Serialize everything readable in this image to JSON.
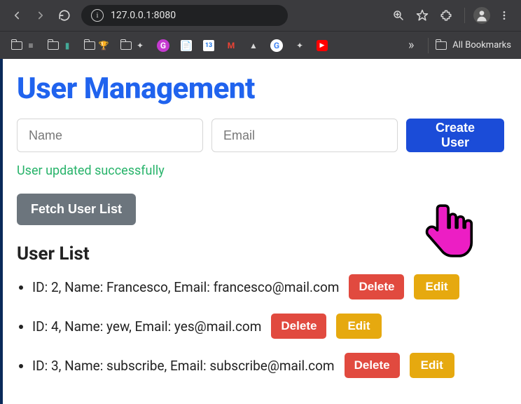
{
  "browser": {
    "url": "127.0.0.1:8080",
    "all_bookmarks": "All Bookmarks"
  },
  "page": {
    "title": "User Management",
    "name_placeholder": "Name",
    "email_placeholder": "Email",
    "create_btn": "Create User",
    "status_msg": "User updated successfully",
    "fetch_btn": "Fetch User List",
    "list_heading": "User List",
    "delete_label": "Delete",
    "edit_label": "Edit",
    "users": [
      {
        "id": 2,
        "name": "Francesco",
        "email": "francesco@mail.com"
      },
      {
        "id": 4,
        "name": "yew",
        "email": "yes@mail.com"
      },
      {
        "id": 3,
        "name": "subscribe",
        "email": "subscribe@mail.com"
      }
    ]
  }
}
